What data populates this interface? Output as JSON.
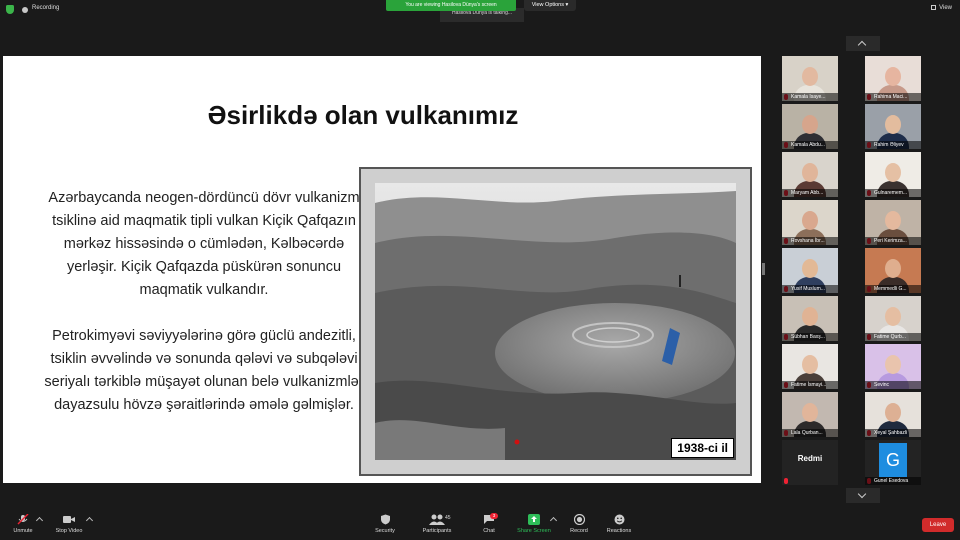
{
  "top": {
    "recording": "Recording",
    "viewing_banner": "You are viewing Hasilova Dünya's screen",
    "shared_tab": "Hasilova Dünya is talking...",
    "view_options": "View Options",
    "view": "View"
  },
  "slide": {
    "title": "Əsirlikdə olan vulkanımız",
    "paragraph1": "Azərbaycanda neogen-dördüncü dövr vulkanizm tsiklinə aid maqmatik tipli vulkan Kiçik Qafqazın mərkəz hissəsində o cümlədən, Kəlbəcərdə yerləşir. Kiçik Qafqazda püskürən sonuncu maqmatik vulkandır.",
    "paragraph2": "Petrokimyəvi səviyyələrinə görə güclü andezitli, tsiklin əvvəlində və sonunda qələvi və subqələvi seriyalı tərkiblə müşayət olunan belə vulkanizmlər dayazsulu hövzə şəraitlərində əmələ gəlmişlər.",
    "photo_caption": "1938-ci il"
  },
  "participants": [
    {
      "name": "Kamala Isaye...",
      "bg": "#d8d2c8",
      "skin": "#e2b9a0",
      "shirt": "#e8e4dc"
    },
    {
      "name": "Rahima Maci...",
      "bg": "#e8ddd7",
      "skin": "#e6b5a0",
      "shirt": "#c79a8a"
    },
    {
      "name": "Kamala Abdu...",
      "bg": "#b9b2a5",
      "skin": "#d6a58c",
      "shirt": "#2f2f34"
    },
    {
      "name": "Rahim Əliyev",
      "bg": "#9aa0a8",
      "skin": "#e3bc9e",
      "shirt": "#1e2d4a"
    },
    {
      "name": "Maryam Abb...",
      "bg": "#d9d4cc",
      "skin": "#e0b59a",
      "shirt": "#5a3a34"
    },
    {
      "name": "Gulnaremem...",
      "bg": "#efece6",
      "skin": "#e5c0a4",
      "shirt": "#3a3230"
    },
    {
      "name": "Rovshana İbr...",
      "bg": "#dcd6cb",
      "skin": "#d9a88e",
      "shirt": "#8c6f5a"
    },
    {
      "name": "Peri Kerimza...",
      "bg": "#bfb3a6",
      "skin": "#e4b99e",
      "shirt": "#6a4e3e"
    },
    {
      "name": "Yusif Muslum...",
      "bg": "#c9cfd6",
      "skin": "#e2b996",
      "shirt": "#2f3f5f"
    },
    {
      "name": "Memmedli G...",
      "bg": "#c67a52",
      "skin": "#dfae8e",
      "shirt": "#3a2c28"
    },
    {
      "name": "Sübhan Baxş...",
      "bg": "#c8c0b6",
      "skin": "#e0b394",
      "shirt": "#2a2a2a"
    },
    {
      "name": "Fatime Qurb...",
      "bg": "#d7d2cc",
      "skin": "#e5bea2",
      "shirt": "#e8e6e4"
    },
    {
      "name": "Fatime İsmayi...",
      "bg": "#e9e6e2",
      "skin": "#e5bea2",
      "shirt": "#4a3f3a"
    },
    {
      "name": "Sevinc",
      "bg": "#d9c1e8",
      "skin": "#e9c4ad",
      "shirt": "#b79adf"
    },
    {
      "name": "Lala Qurban...",
      "bg": "#c2b8b0",
      "skin": "#e1b59a",
      "shirt": "#2d2a2a"
    },
    {
      "name": "Xeyal Şahbazli",
      "bg": "#e6e1db",
      "skin": "#ddb094",
      "shirt": "#1f2a3e"
    },
    {
      "name": "",
      "label": "Redmi"
    },
    {
      "name": "Gunel Esedova",
      "initial": "G"
    }
  ],
  "toolbar": {
    "unmute": "Unmute",
    "stop_video": "Stop Video",
    "security": "Security",
    "participants": "Participants",
    "participants_count": "45",
    "chat": "Chat",
    "chat_badge": "3",
    "share_screen": "Share Screen",
    "record": "Record",
    "reactions": "Reactions",
    "leave": "Leave"
  }
}
